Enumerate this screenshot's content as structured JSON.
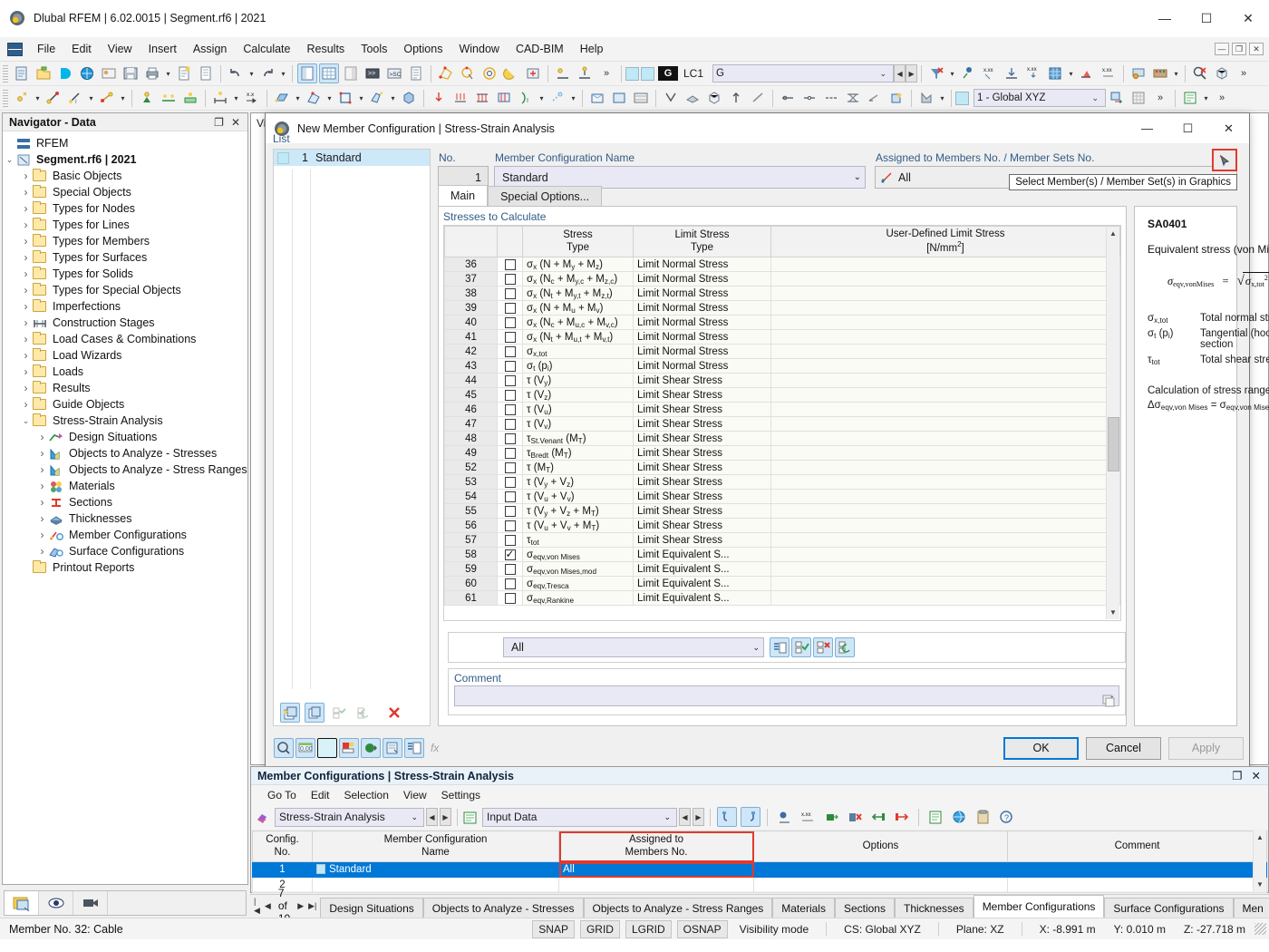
{
  "window": {
    "title": "Dlubal RFEM | 6.02.0015 | Segment.rf6 | 2021",
    "minimize": "—",
    "maximize": "☐",
    "close": "✕"
  },
  "menubar": {
    "items": [
      "File",
      "Edit",
      "View",
      "Insert",
      "Assign",
      "Calculate",
      "Results",
      "Tools",
      "Options",
      "Window",
      "CAD-BIM",
      "Help"
    ],
    "right_buttons": [
      "—",
      "☐",
      "✕"
    ]
  },
  "toolbar": {
    "load_case_label": "LC1",
    "load_case_value": "G",
    "load_case_tag": "G",
    "coord_system": "1 - Global XYZ",
    "overflow": "»"
  },
  "navigator": {
    "title": "Navigator - Data",
    "root": "RFEM",
    "project": "Segment.rf6 | 2021",
    "items": [
      {
        "label": "Basic Objects",
        "icon": "folder-icon",
        "indent": 2,
        "expand": "collapsed"
      },
      {
        "label": "Special Objects",
        "icon": "folder-icon",
        "indent": 2,
        "expand": "collapsed"
      },
      {
        "label": "Types for Nodes",
        "icon": "folder-icon",
        "indent": 2,
        "expand": "collapsed"
      },
      {
        "label": "Types for Lines",
        "icon": "folder-icon",
        "indent": 2,
        "expand": "collapsed"
      },
      {
        "label": "Types for Members",
        "icon": "folder-icon",
        "indent": 2,
        "expand": "collapsed"
      },
      {
        "label": "Types for Surfaces",
        "icon": "folder-icon",
        "indent": 2,
        "expand": "collapsed"
      },
      {
        "label": "Types for Solids",
        "icon": "folder-icon",
        "indent": 2,
        "expand": "collapsed"
      },
      {
        "label": "Types for Special Objects",
        "icon": "folder-icon",
        "indent": 2,
        "expand": "collapsed"
      },
      {
        "label": "Imperfections",
        "icon": "folder-icon",
        "indent": 2,
        "expand": "collapsed"
      },
      {
        "label": "Construction Stages",
        "icon": "stages-icon",
        "indent": 2,
        "expand": "collapsed"
      },
      {
        "label": "Load Cases & Combinations",
        "icon": "folder-icon",
        "indent": 2,
        "expand": "collapsed"
      },
      {
        "label": "Load Wizards",
        "icon": "folder-icon",
        "indent": 2,
        "expand": "collapsed"
      },
      {
        "label": "Loads",
        "icon": "folder-icon",
        "indent": 2,
        "expand": "collapsed"
      },
      {
        "label": "Results",
        "icon": "folder-icon",
        "indent": 2,
        "expand": "collapsed"
      },
      {
        "label": "Guide Objects",
        "icon": "folder-icon",
        "indent": 2,
        "expand": "collapsed"
      },
      {
        "label": "Stress-Strain Analysis",
        "icon": "folder-icon",
        "indent": 2,
        "expand": "expanded"
      },
      {
        "label": "Design Situations",
        "icon": "design-situations-icon",
        "indent": 3,
        "expand": "collapsed"
      },
      {
        "label": "Objects to Analyze - Stresses",
        "icon": "chart-icon",
        "indent": 3,
        "expand": "collapsed"
      },
      {
        "label": "Objects to Analyze - Stress Ranges",
        "icon": "chart-icon",
        "indent": 3,
        "expand": "collapsed"
      },
      {
        "label": "Materials",
        "icon": "materials-icon",
        "indent": 3,
        "expand": "collapsed"
      },
      {
        "label": "Sections",
        "icon": "sections-icon",
        "indent": 3,
        "expand": "collapsed"
      },
      {
        "label": "Thicknesses",
        "icon": "thicknesses-icon",
        "indent": 3,
        "expand": "collapsed"
      },
      {
        "label": "Member Configurations",
        "icon": "member-config-icon",
        "indent": 3,
        "expand": "collapsed"
      },
      {
        "label": "Surface Configurations",
        "icon": "surface-config-icon",
        "indent": 3,
        "expand": "collapsed"
      },
      {
        "label": "Printout Reports",
        "icon": "folder-icon",
        "indent": 2,
        "expand": "none"
      }
    ]
  },
  "mdi": {
    "clipped_label": "Vi"
  },
  "dialog": {
    "title": "New Member Configuration | Stress-Strain Analysis",
    "list_label": "List",
    "list_items": [
      {
        "no": "1",
        "name": "Standard"
      }
    ],
    "no_label": "No.",
    "no_value": "1",
    "name_label": "Member Configuration Name",
    "name_value": "Standard",
    "assigned_label": "Assigned to Members No. / Member Sets No.",
    "assigned_value": "All",
    "tooltip": "Select Member(s) / Member Set(s) in Graphics",
    "tabs": [
      {
        "label": "Main",
        "active": true
      },
      {
        "label": "Special Options...",
        "active": false
      }
    ],
    "group_label": "Stresses to Calculate",
    "columns": [
      "",
      "",
      "Stress\nType",
      "Limit Stress\nType",
      "User-Defined Limit Stress\n[N/mm²]"
    ],
    "col_stress_l1": "Stress",
    "col_stress_l2": "Type",
    "col_limit_l1": "Limit Stress",
    "col_limit_l2": "Type",
    "col_user_l1": "User-Defined Limit Stress",
    "col_user_l2": "[N/mm",
    "col_user_sup": "2",
    "col_user_end": "]",
    "rows": [
      {
        "no": "36",
        "checked": false,
        "type_html": "σ<sub>x</sub> (N + M<sub>y</sub> + M<sub>z</sub>)",
        "limit": "Limit Normal Stress",
        "user": ""
      },
      {
        "no": "37",
        "checked": false,
        "type_html": "σ<sub>x</sub> (N<sub>c</sub> + M<sub>y,c</sub> + M<sub>z,c</sub>)",
        "limit": "Limit Normal Stress",
        "user": ""
      },
      {
        "no": "38",
        "checked": false,
        "type_html": "σ<sub>x</sub> (N<sub>t</sub> + M<sub>y,t</sub> + M<sub>z,t</sub>)",
        "limit": "Limit Normal Stress",
        "user": ""
      },
      {
        "no": "39",
        "checked": false,
        "type_html": "σ<sub>x</sub> (N + M<sub>u</sub> + M<sub>v</sub>)",
        "limit": "Limit Normal Stress",
        "user": ""
      },
      {
        "no": "40",
        "checked": false,
        "type_html": "σ<sub>x</sub> (N<sub>c</sub> + M<sub>u,c</sub> + M<sub>v,c</sub>)",
        "limit": "Limit Normal Stress",
        "user": ""
      },
      {
        "no": "41",
        "checked": false,
        "type_html": "σ<sub>x</sub> (N<sub>t</sub> + M<sub>u,t</sub> + M<sub>v,t</sub>)",
        "limit": "Limit Normal Stress",
        "user": ""
      },
      {
        "no": "42",
        "checked": false,
        "type_html": "σ<sub>x,tot</sub>",
        "limit": "Limit Normal Stress",
        "user": ""
      },
      {
        "no": "43",
        "checked": false,
        "type_html": "σ<sub>t</sub> (p<sub>i</sub>)",
        "limit": "Limit Normal Stress",
        "user": ""
      },
      {
        "no": "44",
        "checked": false,
        "type_html": "τ (V<sub>y</sub>)",
        "limit": "Limit Shear Stress",
        "user": ""
      },
      {
        "no": "45",
        "checked": false,
        "type_html": "τ (V<sub>z</sub>)",
        "limit": "Limit Shear Stress",
        "user": ""
      },
      {
        "no": "46",
        "checked": false,
        "type_html": "τ (V<sub>u</sub>)",
        "limit": "Limit Shear Stress",
        "user": ""
      },
      {
        "no": "47",
        "checked": false,
        "type_html": "τ (V<sub>v</sub>)",
        "limit": "Limit Shear Stress",
        "user": ""
      },
      {
        "no": "48",
        "checked": false,
        "type_html": "τ<sub>St.Venant</sub> (M<sub>T</sub>)",
        "limit": "Limit Shear Stress",
        "user": ""
      },
      {
        "no": "49",
        "checked": false,
        "type_html": "τ<sub>Bredt</sub> (M<sub>T</sub>)",
        "limit": "Limit Shear Stress",
        "user": ""
      },
      {
        "no": "52",
        "checked": false,
        "type_html": "τ (M<sub>T</sub>)",
        "limit": "Limit Shear Stress",
        "user": ""
      },
      {
        "no": "53",
        "checked": false,
        "type_html": "τ (V<sub>y</sub> + V<sub>z</sub>)",
        "limit": "Limit Shear Stress",
        "user": ""
      },
      {
        "no": "54",
        "checked": false,
        "type_html": "τ (V<sub>u</sub> + V<sub>v</sub>)",
        "limit": "Limit Shear Stress",
        "user": ""
      },
      {
        "no": "55",
        "checked": false,
        "type_html": "τ (V<sub>y</sub> + V<sub>z</sub> + M<sub>T</sub>)",
        "limit": "Limit Shear Stress",
        "user": ""
      },
      {
        "no": "56",
        "checked": false,
        "type_html": "τ (V<sub>u</sub> + V<sub>v</sub> + M<sub>T</sub>)",
        "limit": "Limit Shear Stress",
        "user": ""
      },
      {
        "no": "57",
        "checked": false,
        "type_html": "τ<sub>tot</sub>",
        "limit": "Limit Shear Stress",
        "user": ""
      },
      {
        "no": "58",
        "checked": true,
        "type_html": "σ<sub>eqv,von Mises</sub>",
        "limit": "Limit Equivalent S...",
        "user": ""
      },
      {
        "no": "59",
        "checked": false,
        "type_html": "σ<sub>eqv,von Mises,mod</sub>",
        "limit": "Limit Equivalent S...",
        "user": ""
      },
      {
        "no": "60",
        "checked": false,
        "type_html": "σ<sub>eqv,Tresca</sub>",
        "limit": "Limit Equivalent S...",
        "user": ""
      },
      {
        "no": "61",
        "checked": false,
        "type_html": "σ<sub>eqv,Rankine</sub>",
        "limit": "Limit Equivalent S...",
        "user": ""
      }
    ],
    "all_filter_value": "All",
    "comment_label": "Comment",
    "comment_value": "",
    "buttons": {
      "ok": "OK",
      "cancel": "Cancel",
      "apply": "Apply"
    }
  },
  "info": {
    "code": "SA0401",
    "description": "Equivalent stress (von Mises).",
    "formula_lhs": "σ",
    "formula_lhs_sub": "eqv,vonMises",
    "formula_eq": "=",
    "variables": [
      {
        "symbol_html": "σ<sub>x,tot</sub>",
        "desc": "Total normal stress"
      },
      {
        "symbol_html": "σ<sub>t</sub> (p<sub>i</sub>)",
        "desc": "Tangential (hoop) stress due to internal pressure in the pipe section"
      },
      {
        "symbol_html": "τ<sub>tot</sub>",
        "desc": "Total shear stress"
      }
    ],
    "range_title": "Calculation of stress range.",
    "range_formula_html": "Δσ<sub>eqv,von Mises</sub> = σ<sub>eqv,von Mises,max</sub> - σ<sub>eqv,von Mises,min</sub>"
  },
  "bottom_window": {
    "title": "Member Configurations | Stress-Strain Analysis",
    "menu": [
      "Go To",
      "Edit",
      "Selection",
      "View",
      "Settings"
    ],
    "combo1": "Stress-Strain Analysis",
    "combo2": "Input Data",
    "columns": [
      {
        "l1": "Config.",
        "l2": "No."
      },
      {
        "l1": "Member Configuration",
        "l2": "Name"
      },
      {
        "l1": "Assigned to",
        "l2": "Members No.",
        "highlighted": true
      },
      {
        "l1": "Options",
        "l2": ""
      },
      {
        "l1": "Comment",
        "l2": ""
      }
    ],
    "rows": [
      {
        "no": "1",
        "name": "Standard",
        "assigned": "All",
        "options": "",
        "comment": "",
        "selected": true
      },
      {
        "no": "2",
        "name": "",
        "assigned": "",
        "options": "",
        "comment": "",
        "selected": false
      }
    ]
  },
  "tabstrip": {
    "page_indicator": "7 of 10",
    "tabs": [
      {
        "label": "Design Situations",
        "active": false
      },
      {
        "label": "Objects to Analyze - Stresses",
        "active": false
      },
      {
        "label": "Objects to Analyze - Stress Ranges",
        "active": false
      },
      {
        "label": "Materials",
        "active": false
      },
      {
        "label": "Sections",
        "active": false
      },
      {
        "label": "Thicknesses",
        "active": false
      },
      {
        "label": "Member Configurations",
        "active": true
      },
      {
        "label": "Surface Configurations",
        "active": false
      },
      {
        "label": "Men",
        "active": false
      }
    ]
  },
  "statusbar": {
    "message": "Member No. 32: Cable",
    "toggles": [
      "SNAP",
      "GRID",
      "LGRID",
      "OSNAP"
    ],
    "visibility": "Visibility mode",
    "cs": "CS: Global XYZ",
    "plane": "Plane: XZ",
    "x": "X: -8.991 m",
    "y": "Y: 0.010 m",
    "z": "Z: -27.718 m"
  }
}
